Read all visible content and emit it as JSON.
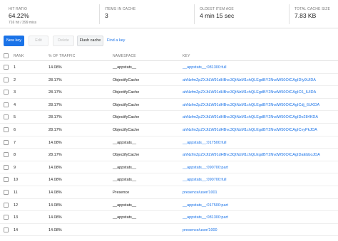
{
  "stats": [
    {
      "label": "HIT RATIO",
      "value": "64.22%",
      "sub": "716 hit / 399 miss"
    },
    {
      "label": "ITEMS IN CACHE",
      "value": "3",
      "sub": ""
    },
    {
      "label": "OLDEST ITEM AGE",
      "value": "4 min 15 sec",
      "sub": ""
    },
    {
      "label": "TOTAL CACHE SIZE",
      "value": "7.83 KB",
      "sub": ""
    }
  ],
  "toolbar": {
    "new_key": "New key",
    "edit": "Edit",
    "delete": "Delete",
    "flush": "Flush cache",
    "find": "Find a key"
  },
  "table": {
    "headers": {
      "rank": "RANK",
      "pct": "% OF TRAFFIC",
      "ns": "NAMESPACE",
      "key": "KEY"
    },
    "rows": [
      {
        "rank": "1",
        "pct": "14.08%",
        "ns": "__appstats__",
        "key": "__appstats__:081300:full"
      },
      {
        "rank": "2",
        "pct": "28.17%",
        "ns": "ObjectifyCache",
        "key": "ahNzfmZpZXJtLW91dHBvc3QtNzM1chQLEgdBY2NvdW50OICAgIDIy9UIDA"
      },
      {
        "rank": "3",
        "pct": "28.17%",
        "ns": "ObjectifyCache",
        "key": "ahNzfmZpZXJtLW91dHBvc3QtNzM1chQLEgdBY2NvdW50OICAgIC6_IUIDA"
      },
      {
        "rank": "4",
        "pct": "28.17%",
        "ns": "ObjectifyCache",
        "key": "ahNzfmZpZXJtLW91dHBvc3QtNzM1chQLEgdBY2NvdW50OICAgICdj_6UKDA"
      },
      {
        "rank": "5",
        "pct": "28.17%",
        "ns": "ObjectifyCache",
        "key": "ahNzfmZpZXJtLW91dHBvc3QtNzM1chQLEgdBY2NvdW50OICAgIDo284KDA"
      },
      {
        "rank": "6",
        "pct": "28.17%",
        "ns": "ObjectifyCache",
        "key": "ahNzfmZpZXJtLW91dHBvc3QtNzM1chQLEgdBY2NvdW50OICAgICvyPkJDA"
      },
      {
        "rank": "7",
        "pct": "14.08%",
        "ns": "__appstats__",
        "key": "__appstats__:017500:full"
      },
      {
        "rank": "8",
        "pct": "28.17%",
        "ns": "ObjectifyCache",
        "key": "ahNzfmZpZXJtLW91dHBvc3QtNzM1chQLEgdBY2NvdW50OICAgIDaEbboJDA"
      },
      {
        "rank": "9",
        "pct": "14.08%",
        "ns": "__appstats__",
        "key": "__appstats__:090700:part"
      },
      {
        "rank": "10",
        "pct": "14.08%",
        "ns": "__appstats__",
        "key": "__appstats__:090700:full"
      },
      {
        "rank": "11",
        "pct": "14.08%",
        "ns": "Presence",
        "key": "presence/user/1001"
      },
      {
        "rank": "12",
        "pct": "14.08%",
        "ns": "__appstats__",
        "key": "__appstats__:017500:part"
      },
      {
        "rank": "13",
        "pct": "14.08%",
        "ns": "__appstats__",
        "key": "__appstats__:081300:part"
      },
      {
        "rank": "14",
        "pct": "14.08%",
        "ns": "",
        "key": "presence/user/1000"
      }
    ]
  },
  "colors": {
    "accent": "#1a73e8",
    "divider": "#e0e0e0",
    "muted": "#757575"
  }
}
